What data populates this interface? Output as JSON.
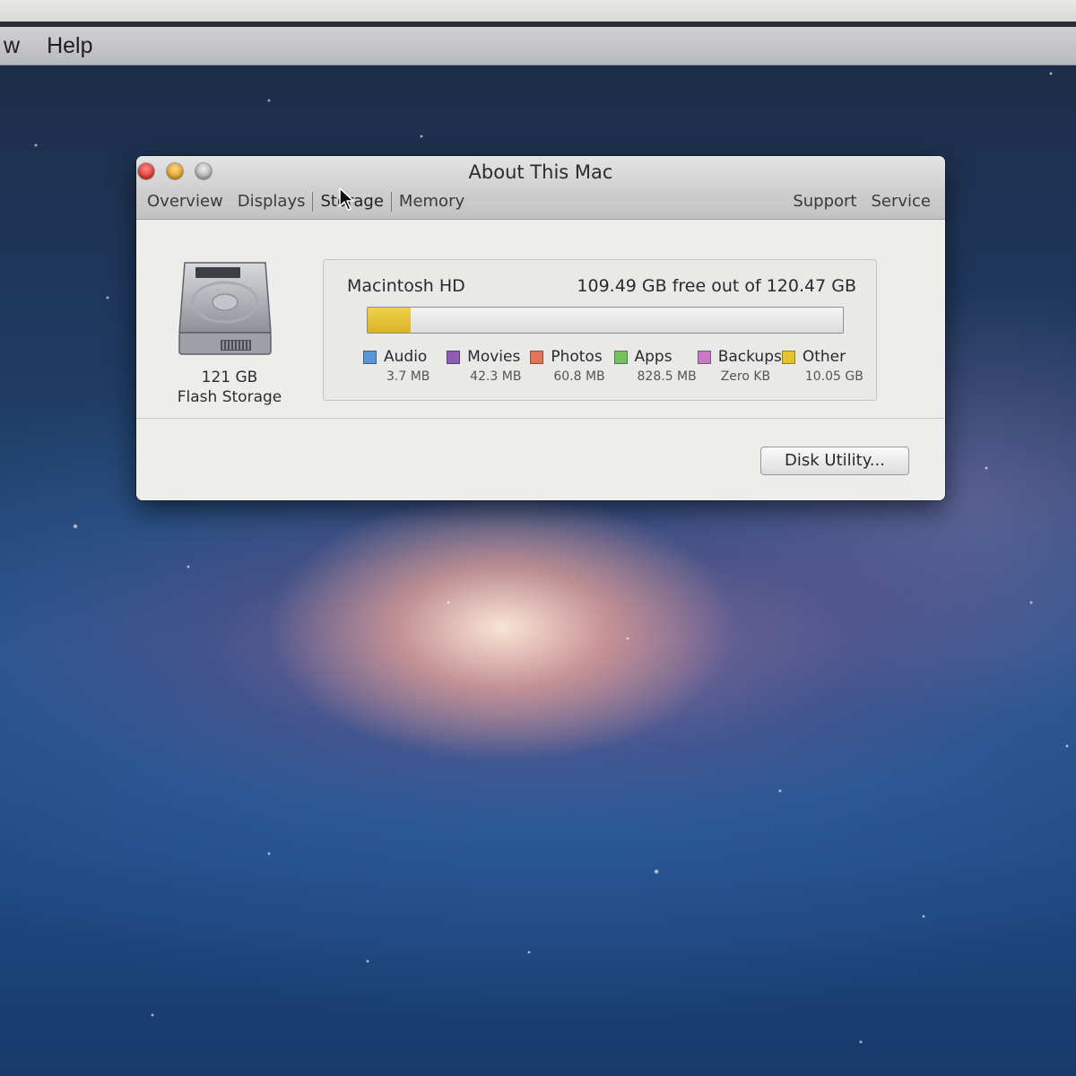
{
  "menubar": {
    "partial_item": "w",
    "help": "Help"
  },
  "window": {
    "title": "About This Mac",
    "tabs_left": [
      {
        "label": "Overview"
      },
      {
        "label": "Displays"
      },
      {
        "label": "Storage"
      },
      {
        "label": "Memory"
      }
    ],
    "tabs_right": [
      {
        "label": "Support"
      },
      {
        "label": "Service"
      }
    ],
    "active_tab": "Storage"
  },
  "drive": {
    "icon": "hard-drive-icon",
    "size": "121 GB",
    "type": "Flash Storage"
  },
  "storage": {
    "volume_name": "Macintosh HD",
    "free_text": "109.49 GB free out of 120.47 GB",
    "used_fraction": 0.091,
    "categories": [
      {
        "label": "Audio",
        "value": "3.7 MB",
        "color": "#5b95d6"
      },
      {
        "label": "Movies",
        "value": "42.3 MB",
        "color": "#8e5cb3"
      },
      {
        "label": "Photos",
        "value": "60.8 MB",
        "color": "#e1765a"
      },
      {
        "label": "Apps",
        "value": "828.5 MB",
        "color": "#77c061"
      },
      {
        "label": "Backups",
        "value": "Zero KB",
        "color": "#c87ac7"
      },
      {
        "label": "Other",
        "value": "10.05 GB",
        "color": "#e3c331"
      }
    ]
  },
  "buttons": {
    "disk_utility": "Disk Utility..."
  }
}
